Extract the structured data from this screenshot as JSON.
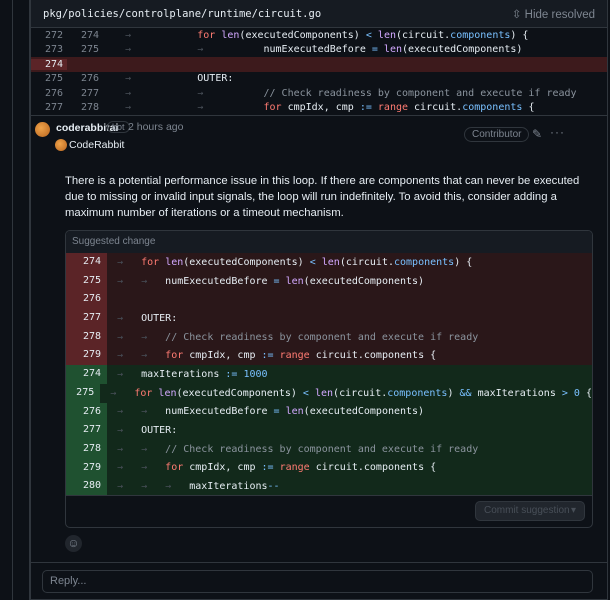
{
  "file": {
    "path": "pkg/policies/controlplane/runtime/circuit.go",
    "hide_resolved": "Hide resolved"
  },
  "diff_lines": [
    {
      "old": "272",
      "new": "274",
      "type": "ctx",
      "tokens": [
        [
          "→\t    ",
          "ar"
        ],
        [
          "for ",
          "kw"
        ],
        [
          "len",
          "fn"
        ],
        [
          "(executedComponents) ",
          "tx"
        ],
        [
          "<",
          "op"
        ],
        [
          " ",
          "tx"
        ],
        [
          "len",
          "fn"
        ],
        [
          "(circuit.",
          "tx"
        ],
        [
          "components",
          "pr"
        ],
        [
          ") {",
          "tx"
        ]
      ]
    },
    {
      "old": "273",
      "new": "275",
      "type": "ctx",
      "tokens": [
        [
          "→\t    →\t       ",
          "ar"
        ],
        [
          "numExecutedBefore ",
          "tx"
        ],
        [
          "=",
          "op"
        ],
        [
          " ",
          "tx"
        ],
        [
          "len",
          "fn"
        ],
        [
          "(executedComponents)",
          "tx"
        ]
      ]
    },
    {
      "old": "274",
      "new": "",
      "type": "del",
      "tokens": []
    },
    {
      "old": "275",
      "new": "276",
      "type": "ctx",
      "tokens": [
        [
          "→\t    ",
          "ar"
        ],
        [
          "OUTER:",
          "tx"
        ]
      ]
    },
    {
      "old": "276",
      "new": "277",
      "type": "ctx",
      "tokens": [
        [
          "→\t    →\t       ",
          "ar"
        ],
        [
          "// Check readiness by component and execute if ready",
          "cm"
        ]
      ]
    },
    {
      "old": "277",
      "new": "278",
      "type": "ctx",
      "tokens": [
        [
          "→\t    →\t       ",
          "ar"
        ],
        [
          "for ",
          "kw"
        ],
        [
          "cmpIdx, cmp ",
          "tx"
        ],
        [
          ":=",
          "op"
        ],
        [
          " ",
          "tx"
        ],
        [
          "range ",
          "kw"
        ],
        [
          "circuit.",
          "tx"
        ],
        [
          "components",
          "pr"
        ],
        [
          " {",
          "tx"
        ]
      ]
    }
  ],
  "comment": {
    "author": "coderabbitai",
    "bot_label": "bot",
    "time": "2 hours ago",
    "role": "Contributor",
    "display_name": "CodeRabbit",
    "body": "There is a potential performance issue in this loop. If there are components that can never be executed due to missing or invalid input signals, the loop will run indefinitely. To avoid this, consider adding a maximum number of iterations or a timeout mechanism."
  },
  "suggestion": {
    "title": "Suggested change",
    "commit_label": "Commit suggestion",
    "lines": [
      {
        "n": "274",
        "type": "del",
        "tokens": [
          [
            "→   ",
            "ar"
          ],
          [
            "for ",
            "kw"
          ],
          [
            "len",
            "fn"
          ],
          [
            "(executedComponents) ",
            "tx"
          ],
          [
            "<",
            "op"
          ],
          [
            " ",
            "tx"
          ],
          [
            "len",
            "fn"
          ],
          [
            "(circuit.",
            "tx"
          ],
          [
            "components",
            "pr"
          ],
          [
            ") {",
            "tx"
          ]
        ]
      },
      {
        "n": "275",
        "type": "del",
        "tokens": [
          [
            "→   →   ",
            "ar"
          ],
          [
            "numExecutedBefore ",
            "tx"
          ],
          [
            "=",
            "op"
          ],
          [
            " ",
            "tx"
          ],
          [
            "len",
            "fn"
          ],
          [
            "(executedComponents)",
            "tx"
          ]
        ]
      },
      {
        "n": "276",
        "type": "del",
        "tokens": []
      },
      {
        "n": "277",
        "type": "del",
        "tokens": [
          [
            "→   ",
            "ar"
          ],
          [
            "OUTER:",
            "tx"
          ]
        ]
      },
      {
        "n": "278",
        "type": "del",
        "tokens": [
          [
            "→   →   ",
            "ar"
          ],
          [
            "// Check readiness by component and execute if ready",
            "cm"
          ]
        ]
      },
      {
        "n": "279",
        "type": "del",
        "tokens": [
          [
            "→   →   ",
            "ar"
          ],
          [
            "for ",
            "kw"
          ],
          [
            "cmpIdx, cmp ",
            "tx"
          ],
          [
            ":=",
            "op"
          ],
          [
            " ",
            "tx"
          ],
          [
            "range ",
            "kw"
          ],
          [
            "circuit.components {",
            "tx"
          ]
        ]
      },
      {
        "n": "274",
        "type": "add",
        "tokens": [
          [
            "→   ",
            "ar"
          ],
          [
            "maxIterations ",
            "tx"
          ],
          [
            ":=",
            "op"
          ],
          [
            " ",
            "tx"
          ],
          [
            "1000",
            "nm"
          ]
        ]
      },
      {
        "n": "275",
        "type": "add",
        "tokens": [
          [
            "→   ",
            "ar"
          ],
          [
            "for ",
            "kw"
          ],
          [
            "len",
            "fn"
          ],
          [
            "(executedComponents) ",
            "tx"
          ],
          [
            "<",
            "op"
          ],
          [
            " ",
            "tx"
          ],
          [
            "len",
            "fn"
          ],
          [
            "(circuit.",
            "tx"
          ],
          [
            "components",
            "pr"
          ],
          [
            ") ",
            "tx"
          ],
          [
            "&&",
            "op"
          ],
          [
            " maxIterations ",
            "tx"
          ],
          [
            ">",
            "op"
          ],
          [
            " ",
            "tx"
          ],
          [
            "0",
            "nm"
          ],
          [
            " {",
            "tx"
          ]
        ]
      },
      {
        "n": "276",
        "type": "add",
        "tokens": [
          [
            "→   →   ",
            "ar"
          ],
          [
            "numExecutedBefore ",
            "tx"
          ],
          [
            "=",
            "op"
          ],
          [
            " ",
            "tx"
          ],
          [
            "len",
            "fn"
          ],
          [
            "(executedComponents)",
            "tx"
          ]
        ]
      },
      {
        "n": "277",
        "type": "add",
        "tokens": [
          [
            "→   ",
            "ar"
          ],
          [
            "OUTER:",
            "tx"
          ]
        ]
      },
      {
        "n": "278",
        "type": "add",
        "tokens": [
          [
            "→   →   ",
            "ar"
          ],
          [
            "// Check readiness by component and execute if ready",
            "cm"
          ]
        ]
      },
      {
        "n": "279",
        "type": "add",
        "tokens": [
          [
            "→   →   ",
            "ar"
          ],
          [
            "for ",
            "kw"
          ],
          [
            "cmpIdx, cmp ",
            "tx"
          ],
          [
            ":=",
            "op"
          ],
          [
            " ",
            "tx"
          ],
          [
            "range ",
            "kw"
          ],
          [
            "circuit.components {",
            "tx"
          ]
        ]
      },
      {
        "n": "280",
        "type": "add",
        "tokens": [
          [
            "→   →   →   ",
            "ar"
          ],
          [
            "maxIterations",
            "tx"
          ],
          [
            "--",
            "op"
          ]
        ]
      }
    ]
  },
  "reply": {
    "placeholder": "Reply..."
  }
}
